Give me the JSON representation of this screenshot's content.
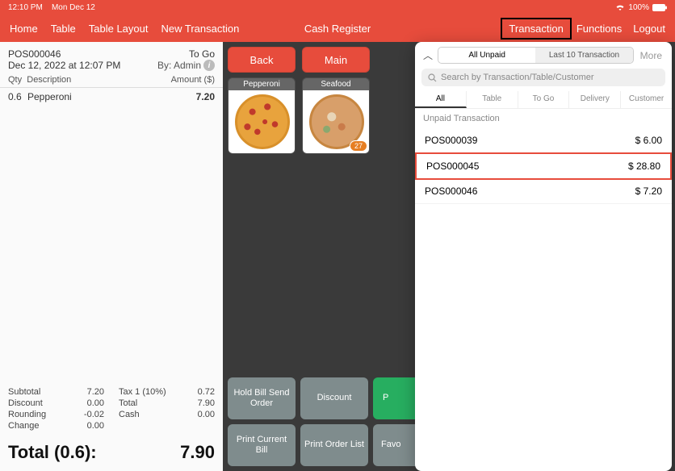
{
  "status_bar": {
    "time": "12:10 PM",
    "date": "Mon Dec 12",
    "battery": "100%"
  },
  "nav": {
    "home": "Home",
    "table": "Table",
    "table_layout": "Table Layout",
    "new_transaction": "New Transaction",
    "title": "Cash Register",
    "transaction": "Transaction",
    "functions": "Functions",
    "logout": "Logout"
  },
  "receipt": {
    "order_id": "POS000046",
    "mode": "To Go",
    "timestamp": "Dec 12, 2022 at 12:07 PM",
    "by_label": "By: Admin",
    "col_qty": "Qty",
    "col_desc": "Description",
    "col_amt": "Amount ($)",
    "items": [
      {
        "qty": "0.6",
        "desc": "Pepperoni",
        "amount": "7.20"
      }
    ],
    "subtotal_label": "Subtotal",
    "subtotal_val": "7.20",
    "tax_label": "Tax 1 (10%)",
    "tax_val": "0.72",
    "discount_label": "Discount",
    "discount_val": "0.00",
    "total2_label": "Total",
    "total2_val": "7.90",
    "rounding_label": "Rounding",
    "rounding_val": "-0.02",
    "cash_label": "Cash",
    "cash_val": "0.00",
    "change_label": "Change",
    "change_val": "0.00",
    "grand_label": "Total (0.6):",
    "grand_val": "7.90"
  },
  "main": {
    "back": "Back",
    "main_btn": "Main",
    "products": [
      {
        "name": "Pepperoni",
        "variant": "pepperoni",
        "badge": ""
      },
      {
        "name": "Seafood",
        "variant": "seafood",
        "badge": "27"
      }
    ],
    "actions": {
      "hold": "Hold Bill Send Order",
      "discount": "Discount",
      "pay_prefix": "P",
      "print_current": "Print Current Bill",
      "print_order": "Print Order List",
      "favo": "Favo"
    }
  },
  "popover": {
    "seg_unpaid": "All Unpaid",
    "seg_last10": "Last 10 Transaction",
    "more": "More",
    "search_placeholder": "Search by Transaction/Table/Customer",
    "tabs": {
      "all": "All",
      "table": "Table",
      "togo": "To Go",
      "delivery": "Delivery",
      "customer": "Customer"
    },
    "section": "Unpaid Transaction",
    "rows": [
      {
        "id": "POS000039",
        "amount": "$ 6.00",
        "highlight": false
      },
      {
        "id": "POS000045",
        "amount": "$ 28.80",
        "highlight": true
      },
      {
        "id": "POS000046",
        "amount": "$ 7.20",
        "highlight": false
      }
    ]
  }
}
